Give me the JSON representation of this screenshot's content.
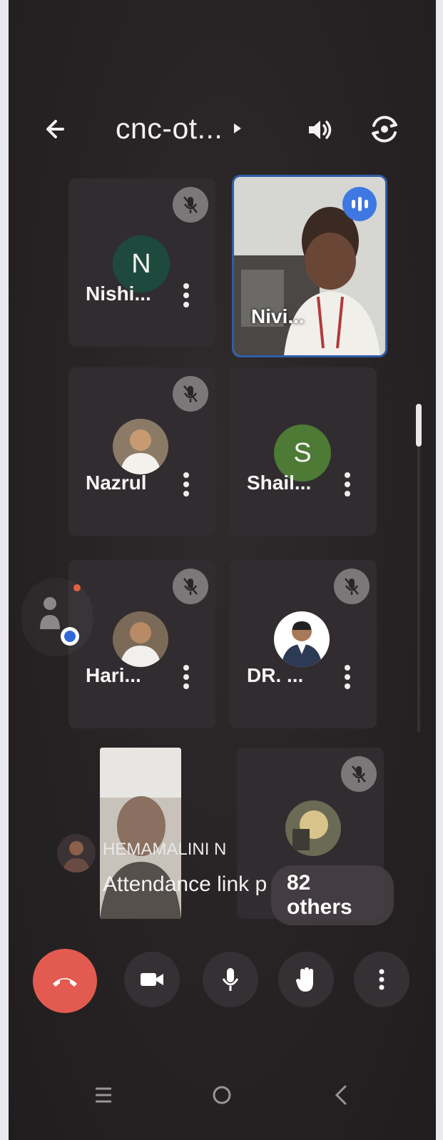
{
  "header": {
    "title": "cnc-ot...",
    "back_icon": "arrow-left-icon",
    "speaker_icon": "speaker-icon",
    "camera_switch_icon": "camera-rotate-icon"
  },
  "participants": [
    {
      "name": "Nishi...",
      "avatar_letter": "N",
      "avatar_color": "#1e4a3d",
      "muted": true
    },
    {
      "name": "Nivi...",
      "video": true,
      "speaking": true
    },
    {
      "name": "Nazrul",
      "photo": true,
      "muted": true
    },
    {
      "name": "Shail...",
      "avatar_letter": "S",
      "avatar_color": "#4d7a35",
      "muted": false
    },
    {
      "name": "Hari...",
      "photo": true,
      "muted": true
    },
    {
      "name": "DR. ...",
      "photo": true,
      "muted": true
    }
  ],
  "caption": {
    "speaker": "HEMAMALINI N",
    "text": "Attendance link p",
    "others": "82 others"
  },
  "controls": {
    "end_call_icon": "phone-hangup-icon",
    "camera_icon": "video-camera-icon",
    "mic_icon": "microphone-icon",
    "hand_icon": "raise-hand-icon",
    "more_icon": "more-vertical-icon"
  },
  "colors": {
    "end_call": "#e35b50",
    "speaking_border": "#2f5ea8",
    "background": "#262224"
  },
  "system_nav": [
    "recents",
    "home",
    "back"
  ]
}
